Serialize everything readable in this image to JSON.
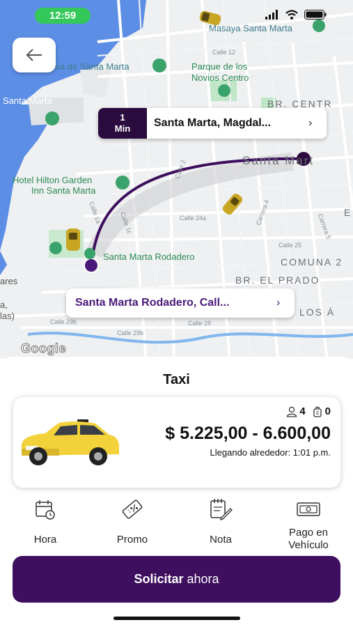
{
  "status_bar": {
    "time": "12:59"
  },
  "map": {
    "labels": {
      "masaya": "Masaya Santa Marta",
      "calle12": "Calle 12",
      "marina": "nía de Santa Marta",
      "parque_line1": "Parque de los",
      "parque_line2": "Novios Centro",
      "br_centro": "BR. CENTR",
      "santa_marta_port": "Santa Marta",
      "hilton_line1": "Hotel Hilton Garden",
      "hilton_line2": "Inn Santa Marta",
      "santa_marta_city": "Santa Mart",
      "east_e": "E",
      "carrera4": "Carrera 4",
      "calle24a": "Calle 24a",
      "calle25": "Calle 25",
      "carrera5": "Carrera 5",
      "rodadero_poi": "Santa Marta Rodadero",
      "comuna2": "COMUNA 2",
      "br_prado": "BR. EL PRADO",
      "los_an": "LOS Á",
      "calle29b": "Calle 29b",
      "calle29b_2": "Calle 29b",
      "calle29": "Calle 29",
      "left_ares": "ares",
      "left_a": "a,",
      "left_las": "las)",
      "calle1a": "Calle 1a",
      "calle1c": "Calle 1c",
      "calle2": "Calle 2"
    },
    "google_logo": "Google",
    "destination": {
      "eta_value": "1",
      "eta_unit": "Min",
      "address": "Santa Marta, Magdal...",
      "chevron": "›"
    },
    "origin": {
      "address": "Santa Marta Rodadero, Call...",
      "chevron": "›"
    },
    "route_color": "#3d0f5e"
  },
  "sheet": {
    "title": "Taxi",
    "vehicle": {
      "passengers": "4",
      "luggage": "0",
      "price": "$ 5.225,00 - 6.600,00",
      "arrival": "Llegando alrededor: 1:01 p.m."
    },
    "options": [
      {
        "label": "Hora",
        "icon": "calendar-clock-icon"
      },
      {
        "label": "Promo",
        "icon": "promo-ticket-icon"
      },
      {
        "label": "Nota",
        "icon": "note-pencil-icon"
      },
      {
        "label_line1": "Pago en",
        "label_line2": "Vehículo",
        "icon": "cash-icon"
      }
    ],
    "cta": {
      "bold": "Solicitar",
      "rest": " ahora"
    }
  },
  "colors": {
    "brand_purple": "#3d0f5e",
    "status_green": "#34c759",
    "taxi_yellow": "#f2d13a"
  }
}
